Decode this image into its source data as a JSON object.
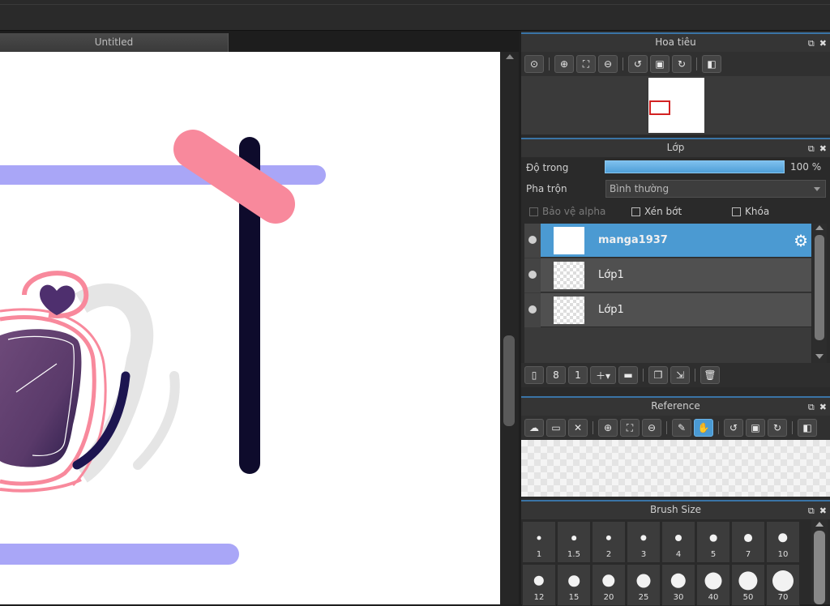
{
  "canvas": {
    "tab_title": "Untitled"
  },
  "navigator": {
    "title": "Hoa tiêu",
    "tools": [
      "zoom-actual-icon",
      "zoom-in-icon",
      "fit-icon",
      "zoom-out-icon",
      "rotate-left-icon",
      "reset-rotation-icon",
      "rotate-right-icon",
      "flip-horizontal-icon"
    ]
  },
  "layers": {
    "title": "Lớp",
    "opacity_label": "Độ trong",
    "opacity_value": "100 %",
    "opacity_fraction": 1.0,
    "blend_label": "Pha trộn",
    "blend_value": "Bình thường",
    "protect_alpha": "Bảo vệ alpha",
    "clipping": "Xén bớt",
    "lock": "Khóa",
    "items": [
      {
        "name": "manga1937",
        "selected": true
      },
      {
        "name": "Lớp1",
        "selected": false
      },
      {
        "name": "Lớp1",
        "selected": false
      }
    ],
    "tools": [
      "new-layer-icon",
      "new-layer-8bit-icon",
      "new-layer-1bit-icon",
      "add-layer-menu-icon",
      "folder-icon",
      "duplicate-layer-icon",
      "merge-down-icon",
      "delete-layer-icon"
    ]
  },
  "reference": {
    "title": "Reference",
    "tools": [
      "cloud-icon",
      "open-folder-icon",
      "close-icon",
      "zoom-in-icon",
      "fit-icon",
      "zoom-out-icon",
      "eyedropper-icon",
      "hand-icon",
      "rotate-left-icon",
      "reset-rotation-icon",
      "rotate-right-icon",
      "flip-horizontal-icon"
    ]
  },
  "brush_size": {
    "title": "Brush Size",
    "sizes": [
      "1",
      "1.5",
      "2",
      "3",
      "4",
      "5",
      "7",
      "10",
      "12",
      "15",
      "20",
      "25",
      "30",
      "40",
      "50",
      "70"
    ]
  },
  "colors": {
    "accent": "#4b9ad2",
    "panel_border": "#3a74a6",
    "lavender_stroke": "#a9a6f7",
    "pink_stroke": "#f8899c",
    "navy_stroke": "#0e0b2c"
  }
}
